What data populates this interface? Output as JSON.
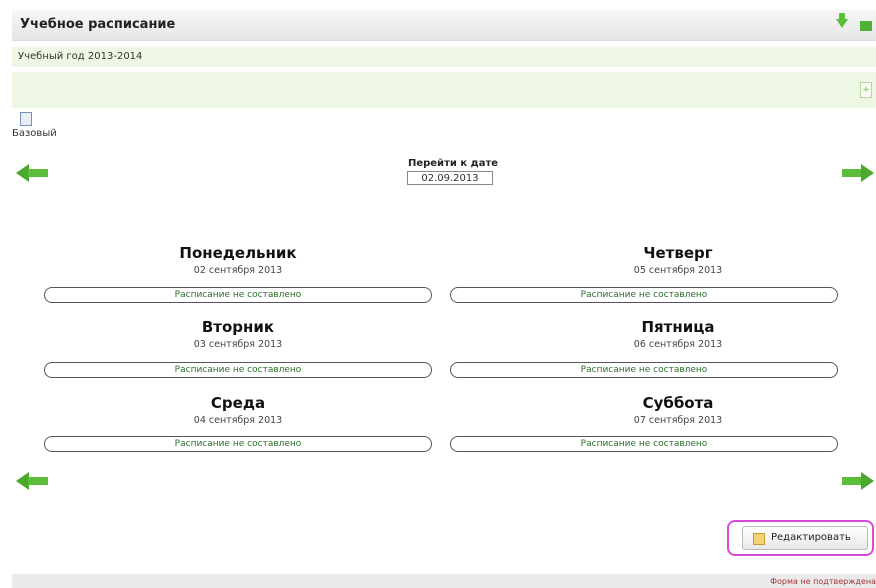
{
  "header": {
    "title": "Учебное расписание"
  },
  "year": {
    "label": "Учебный год 2013-2014"
  },
  "variant": {
    "label": "Базовый"
  },
  "goto": {
    "label": "Перейти к дате",
    "value": "02.09.2013"
  },
  "days": [
    {
      "name": "Понедельник",
      "date": "02 сентября 2013",
      "status": "Расписание не составлено"
    },
    {
      "name": "Четверг",
      "date": "05 сентября 2013",
      "status": "Расписание не составлено"
    },
    {
      "name": "Вторник",
      "date": "03 сентября 2013",
      "status": "Расписание не составлено"
    },
    {
      "name": "Пятница",
      "date": "06 сентября 2013",
      "status": "Расписание не составлено"
    },
    {
      "name": "Среда",
      "date": "04 сентября 2013",
      "status": "Расписание не составлено"
    },
    {
      "name": "Суббота",
      "date": "07 сентября 2013",
      "status": "Расписание не составлено"
    }
  ],
  "edit_button": {
    "label": "Редактировать"
  },
  "footer": {
    "text": "Форма не подтверждена"
  },
  "colors": {
    "accent_green": "#5cbd3a",
    "status_text": "#2b6f2b",
    "highlight": "#d84bd8"
  }
}
